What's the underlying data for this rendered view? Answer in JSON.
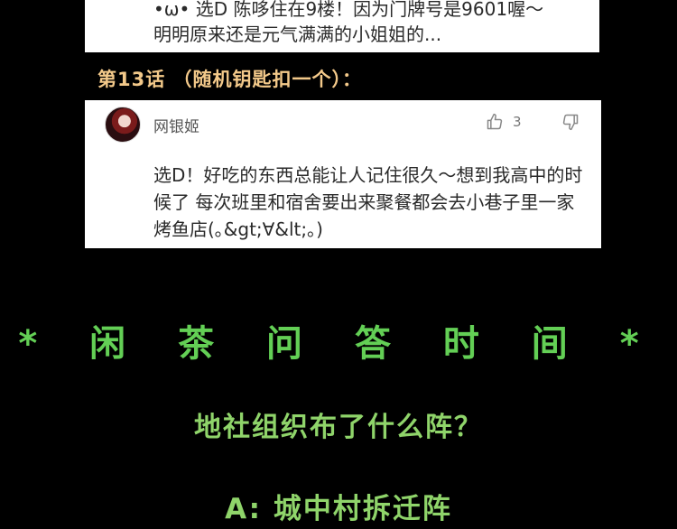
{
  "top_comment": {
    "line1": "•ω• 选D 陈哆住在9楼！因为门牌号是9601喔～",
    "line2": "明明原来还是元气满满的小姐姐的..."
  },
  "chapter_heading": "第13话 （随机钥匙扣一个）：",
  "comment": {
    "avatar_icon": "avatar-icon",
    "username": "网银姬",
    "like_icon": "thumbs-up-icon",
    "like_count": "3",
    "dislike_icon": "thumbs-down-icon",
    "text": "选D！好吃的东西总能让人记住很久～想到我高中的时候了 每次班里和宿舍要出来聚餐都会去小巷子里一家烤鱼店(｡&gt;∀&lt;｡)"
  },
  "section": {
    "title": "* 闲 茶 问 答 时 间 *",
    "question": "地社组织布了什么阵？",
    "answer": "A: 城中村拆迁阵"
  },
  "colors": {
    "background": "#000000",
    "title_green": "#63cf55",
    "text_green": "#8fd46a",
    "heading_gold": "#f3c98a"
  }
}
